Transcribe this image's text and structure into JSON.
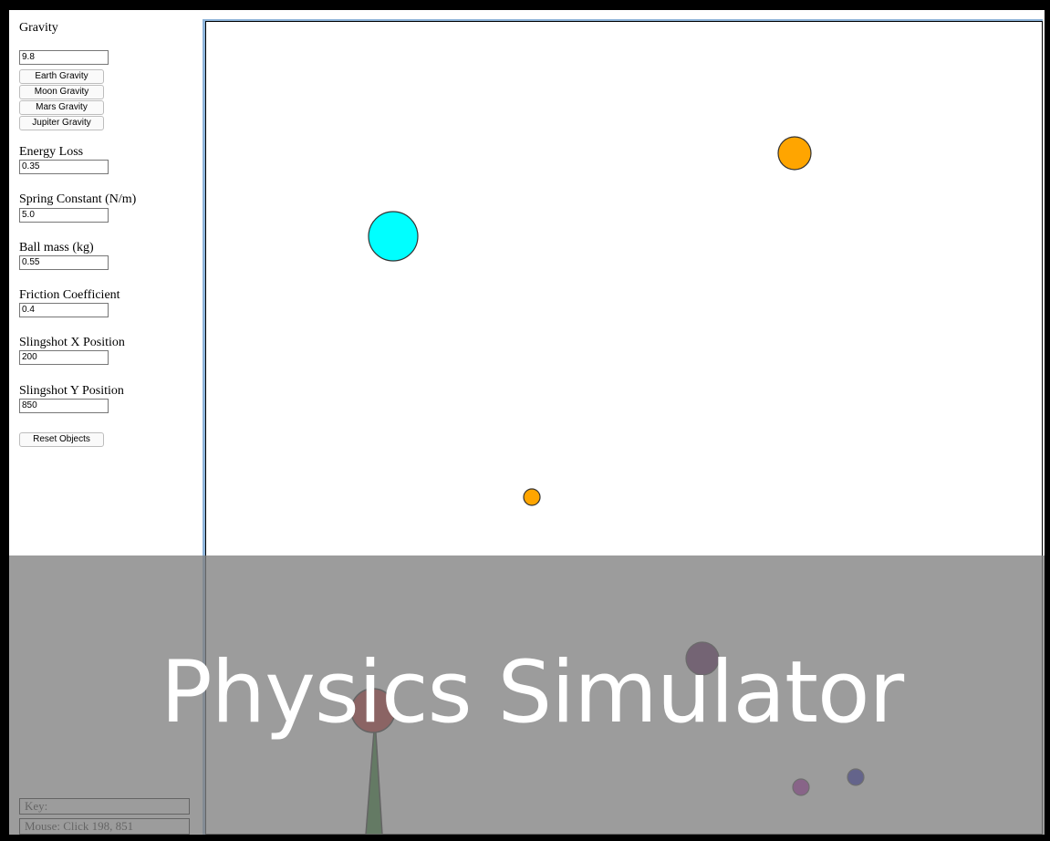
{
  "controls": {
    "gravity": {
      "label": "Gravity",
      "value": "9.8",
      "presets": [
        "Earth Gravity",
        "Moon Gravity",
        "Mars Gravity",
        "Jupiter Gravity"
      ]
    },
    "energy_loss": {
      "label": "Energy Loss",
      "value": "0.35"
    },
    "spring_constant": {
      "label": "Spring Constant (N/m)",
      "value": "5.0"
    },
    "ball_mass": {
      "label": "Ball mass (kg)",
      "value": "0.55"
    },
    "friction": {
      "label": "Friction Coefficient",
      "value": "0.4"
    },
    "slingshot_x": {
      "label": "Slingshot X Position",
      "value": "200"
    },
    "slingshot_y": {
      "label": "Slingshot Y Position",
      "value": "850"
    },
    "reset_label": "Reset Objects"
  },
  "status": {
    "key_text": "Key:",
    "mouse_text": "Mouse: Click 198, 851"
  },
  "overlay": {
    "title": "Physics Simulator"
  },
  "simulation": {
    "colors": {
      "cyan": "#00ffff",
      "orange": "#ffa500",
      "purple": "#4b004b",
      "red": "#b30000",
      "magenta": "#a300a3",
      "blue": "#0000b0",
      "slingshot": "#006400"
    }
  }
}
